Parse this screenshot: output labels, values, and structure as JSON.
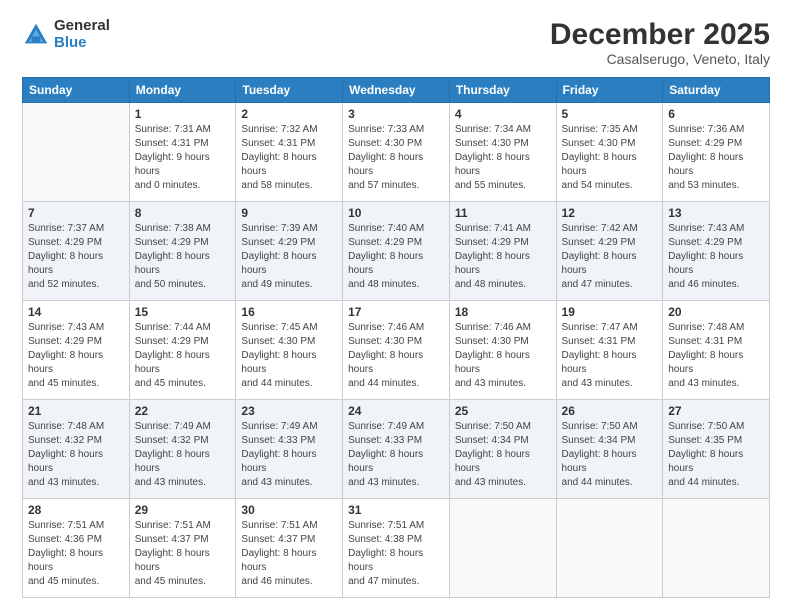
{
  "logo": {
    "general": "General",
    "blue": "Blue"
  },
  "header": {
    "month": "December 2025",
    "location": "Casalserugo, Veneto, Italy"
  },
  "weekdays": [
    "Sunday",
    "Monday",
    "Tuesday",
    "Wednesday",
    "Thursday",
    "Friday",
    "Saturday"
  ],
  "weeks": [
    [
      {
        "day": "",
        "sunrise": "",
        "sunset": "",
        "daylight": ""
      },
      {
        "day": "1",
        "sunrise": "7:31 AM",
        "sunset": "4:31 PM",
        "daylight": "9 hours and 0 minutes."
      },
      {
        "day": "2",
        "sunrise": "7:32 AM",
        "sunset": "4:31 PM",
        "daylight": "8 hours and 58 minutes."
      },
      {
        "day": "3",
        "sunrise": "7:33 AM",
        "sunset": "4:30 PM",
        "daylight": "8 hours and 57 minutes."
      },
      {
        "day": "4",
        "sunrise": "7:34 AM",
        "sunset": "4:30 PM",
        "daylight": "8 hours and 55 minutes."
      },
      {
        "day": "5",
        "sunrise": "7:35 AM",
        "sunset": "4:30 PM",
        "daylight": "8 hours and 54 minutes."
      },
      {
        "day": "6",
        "sunrise": "7:36 AM",
        "sunset": "4:29 PM",
        "daylight": "8 hours and 53 minutes."
      }
    ],
    [
      {
        "day": "7",
        "sunrise": "7:37 AM",
        "sunset": "4:29 PM",
        "daylight": "8 hours and 52 minutes."
      },
      {
        "day": "8",
        "sunrise": "7:38 AM",
        "sunset": "4:29 PM",
        "daylight": "8 hours and 50 minutes."
      },
      {
        "day": "9",
        "sunrise": "7:39 AM",
        "sunset": "4:29 PM",
        "daylight": "8 hours and 49 minutes."
      },
      {
        "day": "10",
        "sunrise": "7:40 AM",
        "sunset": "4:29 PM",
        "daylight": "8 hours and 48 minutes."
      },
      {
        "day": "11",
        "sunrise": "7:41 AM",
        "sunset": "4:29 PM",
        "daylight": "8 hours and 48 minutes."
      },
      {
        "day": "12",
        "sunrise": "7:42 AM",
        "sunset": "4:29 PM",
        "daylight": "8 hours and 47 minutes."
      },
      {
        "day": "13",
        "sunrise": "7:43 AM",
        "sunset": "4:29 PM",
        "daylight": "8 hours and 46 minutes."
      }
    ],
    [
      {
        "day": "14",
        "sunrise": "7:43 AM",
        "sunset": "4:29 PM",
        "daylight": "8 hours and 45 minutes."
      },
      {
        "day": "15",
        "sunrise": "7:44 AM",
        "sunset": "4:29 PM",
        "daylight": "8 hours and 45 minutes."
      },
      {
        "day": "16",
        "sunrise": "7:45 AM",
        "sunset": "4:30 PM",
        "daylight": "8 hours and 44 minutes."
      },
      {
        "day": "17",
        "sunrise": "7:46 AM",
        "sunset": "4:30 PM",
        "daylight": "8 hours and 44 minutes."
      },
      {
        "day": "18",
        "sunrise": "7:46 AM",
        "sunset": "4:30 PM",
        "daylight": "8 hours and 43 minutes."
      },
      {
        "day": "19",
        "sunrise": "7:47 AM",
        "sunset": "4:31 PM",
        "daylight": "8 hours and 43 minutes."
      },
      {
        "day": "20",
        "sunrise": "7:48 AM",
        "sunset": "4:31 PM",
        "daylight": "8 hours and 43 minutes."
      }
    ],
    [
      {
        "day": "21",
        "sunrise": "7:48 AM",
        "sunset": "4:32 PM",
        "daylight": "8 hours and 43 minutes."
      },
      {
        "day": "22",
        "sunrise": "7:49 AM",
        "sunset": "4:32 PM",
        "daylight": "8 hours and 43 minutes."
      },
      {
        "day": "23",
        "sunrise": "7:49 AM",
        "sunset": "4:33 PM",
        "daylight": "8 hours and 43 minutes."
      },
      {
        "day": "24",
        "sunrise": "7:49 AM",
        "sunset": "4:33 PM",
        "daylight": "8 hours and 43 minutes."
      },
      {
        "day": "25",
        "sunrise": "7:50 AM",
        "sunset": "4:34 PM",
        "daylight": "8 hours and 43 minutes."
      },
      {
        "day": "26",
        "sunrise": "7:50 AM",
        "sunset": "4:34 PM",
        "daylight": "8 hours and 44 minutes."
      },
      {
        "day": "27",
        "sunrise": "7:50 AM",
        "sunset": "4:35 PM",
        "daylight": "8 hours and 44 minutes."
      }
    ],
    [
      {
        "day": "28",
        "sunrise": "7:51 AM",
        "sunset": "4:36 PM",
        "daylight": "8 hours and 45 minutes."
      },
      {
        "day": "29",
        "sunrise": "7:51 AM",
        "sunset": "4:37 PM",
        "daylight": "8 hours and 45 minutes."
      },
      {
        "day": "30",
        "sunrise": "7:51 AM",
        "sunset": "4:37 PM",
        "daylight": "8 hours and 46 minutes."
      },
      {
        "day": "31",
        "sunrise": "7:51 AM",
        "sunset": "4:38 PM",
        "daylight": "8 hours and 47 minutes."
      },
      {
        "day": "",
        "sunrise": "",
        "sunset": "",
        "daylight": ""
      },
      {
        "day": "",
        "sunrise": "",
        "sunset": "",
        "daylight": ""
      },
      {
        "day": "",
        "sunrise": "",
        "sunset": "",
        "daylight": ""
      }
    ]
  ],
  "labels": {
    "sunrise": "Sunrise:",
    "sunset": "Sunset:",
    "daylight": "Daylight:"
  }
}
